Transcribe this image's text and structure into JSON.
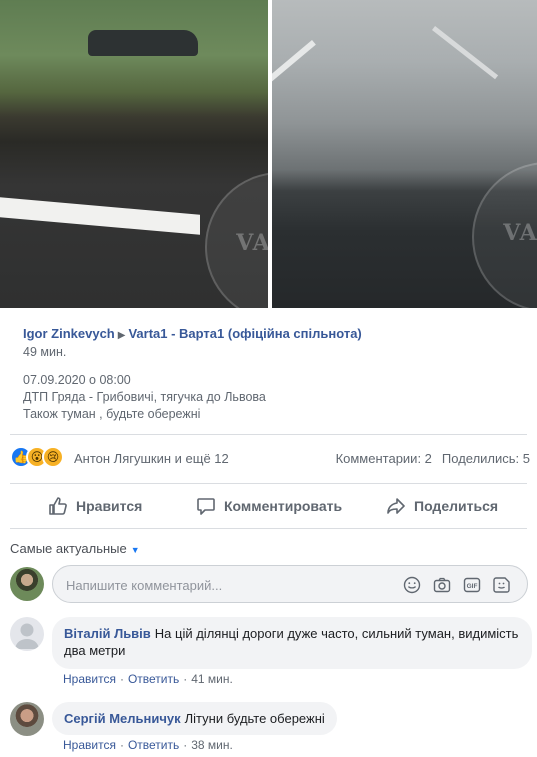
{
  "photos": {
    "left": {
      "watermark": "VARTA"
    },
    "right": {
      "watermark": "VARTA"
    }
  },
  "post": {
    "author": "Igor Zinkevych",
    "group": "Varta1 - Варта1 (офіційна спільнота)",
    "time_ago": "49 мин.",
    "lines": [
      "07.09.2020 о 08:00",
      "ДТП Гряда - Грибовичі, тягучка до Львова",
      "Також туман , будьте обережні"
    ]
  },
  "reactions": {
    "icons": [
      "like-icon",
      "wow-icon",
      "sad-icon"
    ],
    "names": "Антон Лягушкин и ещё 12",
    "comments": "Комментарии: 2",
    "shares": "Поделились: 5"
  },
  "actions": {
    "like": "Нравится",
    "comment": "Комментировать",
    "share": "Поделиться"
  },
  "comments_section": {
    "sort_label": "Самые актуальные",
    "input_placeholder": "Напишите комментарий...",
    "input_icons": [
      "emoji-icon",
      "camera-icon",
      "gif-icon",
      "sticker-icon"
    ]
  },
  "comments": [
    {
      "name": "Віталій Львів",
      "text": "На цій ділянці дороги дуже часто, сильний туман, видимість два метри",
      "like": "Нравится",
      "reply": "Ответить",
      "time": "41 мин."
    },
    {
      "name": "Сергій Мельничук",
      "text": "Літуни будьте обережні",
      "like": "Нравится",
      "reply": "Ответить",
      "time": "38 мин."
    }
  ],
  "colors": {
    "link": "#385898",
    "accent": "#1877f2",
    "muted": "#606770"
  }
}
